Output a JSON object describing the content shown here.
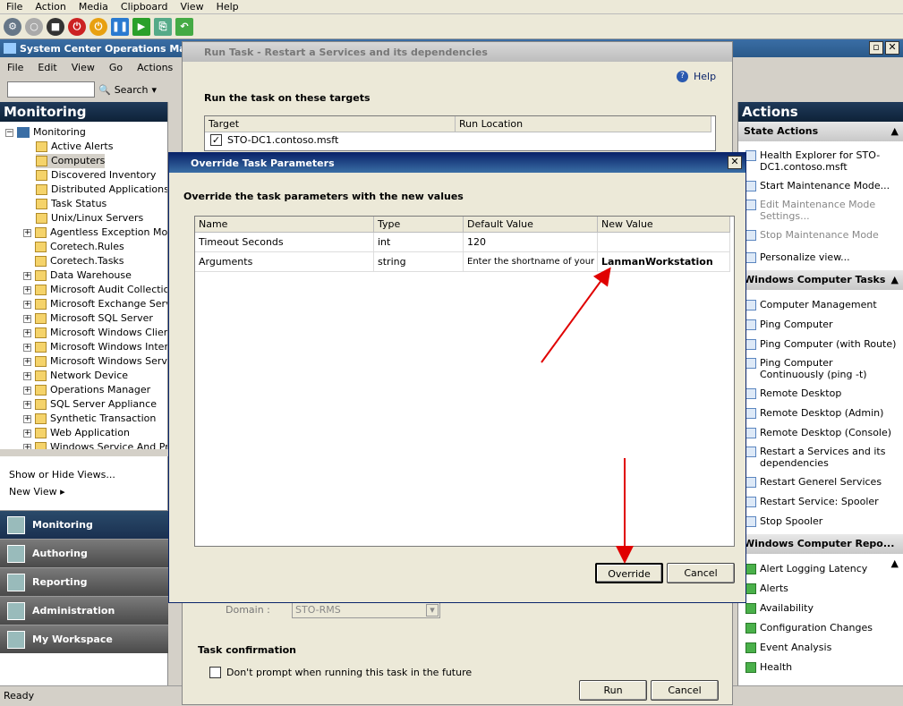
{
  "vm_menu": [
    "File",
    "Action",
    "Media",
    "Clipboard",
    "View",
    "Help"
  ],
  "main": {
    "title": "System Center Operations Mana",
    "menu": [
      "File",
      "Edit",
      "View",
      "Go",
      "Actions"
    ],
    "search_label": "Search"
  },
  "left": {
    "header": "Monitoring",
    "root": "Monitoring",
    "items": [
      "Active Alerts",
      "Computers",
      "Discovered Inventory",
      "Distributed Applications",
      "Task Status",
      "Unix/Linux Servers",
      "Agentless Exception Monit",
      "Coretech.Rules",
      "Coretech.Tasks",
      "Data Warehouse",
      "Microsoft Audit Collection S",
      "Microsoft Exchange Serve",
      "Microsoft SQL Server",
      "Microsoft Windows Client",
      "Microsoft Windows Interne",
      "Microsoft Windows Server",
      "Network Device",
      "Operations Manager",
      "SQL Server Appliance",
      "Synthetic Transaction",
      "Web Application",
      "Windows Service And Pro"
    ],
    "show_hide": "Show or Hide Views...",
    "new_view": "New View ▸",
    "nav": [
      "Monitoring",
      "Authoring",
      "Reporting",
      "Administration",
      "My Workspace"
    ]
  },
  "status": "Ready",
  "run_task": {
    "title": "Run Task - Restart a Services and its dependencies",
    "help": "Help",
    "targets_heading": "Run the task on these targets",
    "col_target": "Target",
    "col_location": "Run Location",
    "target_value": "STO-DC1.contoso.msft",
    "domain_label": "Domain :",
    "domain_value": "STO-RMS",
    "confirm_heading": "Task confirmation",
    "confirm_check": "Don't prompt when running this task in the future",
    "run": "Run",
    "cancel": "Cancel"
  },
  "override": {
    "title": "Override Task Parameters",
    "heading": "Override the task parameters with the new values",
    "cols": [
      "Name",
      "Type",
      "Default Value",
      "New Value"
    ],
    "rows": [
      [
        "Timeout Seconds",
        "int",
        "120",
        ""
      ],
      [
        "Arguments",
        "string",
        "Enter the shortname of your ...",
        "LanmanWorkstation"
      ]
    ],
    "override_btn": "Override",
    "cancel_btn": "Cancel"
  },
  "actions": {
    "header": "Actions",
    "state_head": "State Actions",
    "state": [
      "Health Explorer for STO-DC1.contoso.msft",
      "Start Maintenance Mode...",
      "Edit Maintenance Mode Settings...",
      "Stop Maintenance Mode",
      "Personalize view..."
    ],
    "tasks_head": "Windows Computer Tasks",
    "tasks": [
      "Computer Management",
      "Ping Computer",
      "Ping Computer (with Route)",
      "Ping Computer Continuously (ping -t)",
      "Remote Desktop",
      "Remote Desktop (Admin)",
      "Remote Desktop (Console)",
      "Restart a Services and its dependencies",
      "Restart Generel Services",
      "Restart Service: Spooler",
      "Stop Spooler"
    ],
    "reports_head": "Windows Computer Repo...",
    "reports": [
      "Alert Logging Latency",
      "Alerts",
      "Availability",
      "Configuration Changes",
      "Event Analysis",
      "Health"
    ]
  },
  "colors": {
    "arrow": "#e00000"
  }
}
